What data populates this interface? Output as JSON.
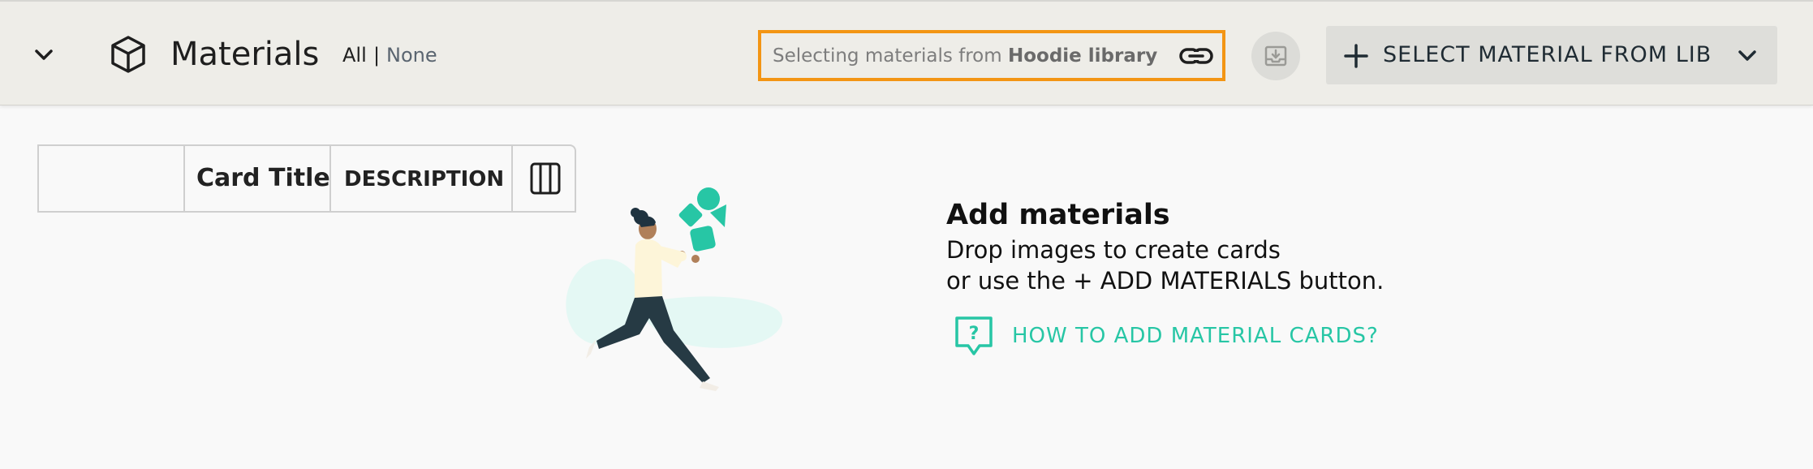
{
  "header": {
    "title": "Materials",
    "select_all": "All",
    "separator": "|",
    "select_none": "None",
    "library_prefix": "Selecting materials from",
    "library_name": "Hoodie library",
    "select_material_button": "SELECT MATERIAL FROM LIB",
    "icons": {
      "collapse": "chevron-down-icon",
      "module": "cube-icon",
      "link": "link-icon",
      "import": "download-tray-icon",
      "add": "plus-icon",
      "dropdown": "chevron-down-icon"
    }
  },
  "table": {
    "columns": [
      "",
      "Card Title",
      "DESCRIPTION"
    ],
    "columns_icon": "columns-icon"
  },
  "empty_state": {
    "title": "Add materials",
    "line1": "Drop images to create cards",
    "line2": "or use the + ADD MATERIALS button.",
    "help_link": "HOW TO ADD MATERIAL CARDS?",
    "help_icon": "question-bubble-icon"
  },
  "colors": {
    "accent": "#27c6a5",
    "highlight_border": "#f39514",
    "topbar_bg": "#eeede8",
    "page_bg": "#f9f9f9"
  }
}
